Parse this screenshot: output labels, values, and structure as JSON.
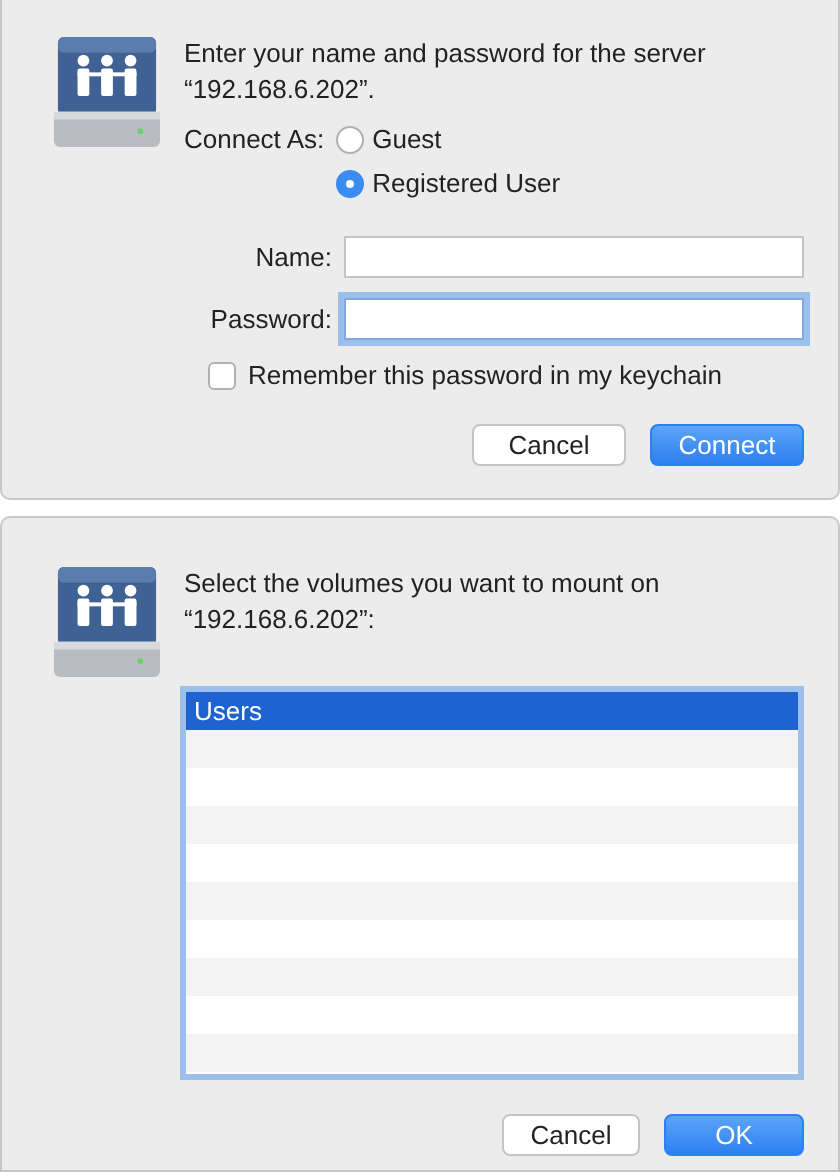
{
  "login_dialog": {
    "message": "Enter your name and password for the server “192.168.6.202”.",
    "connect_as_label": "Connect As:",
    "connect_as_options": [
      {
        "label": "Guest",
        "selected": false
      },
      {
        "label": "Registered User",
        "selected": true
      }
    ],
    "fields": [
      {
        "label": "Name:",
        "focused": false
      },
      {
        "label": "Password:",
        "focused": true
      }
    ],
    "remember": {
      "label": "Remember this password in my keychain",
      "checked": false
    },
    "buttons": [
      {
        "label": "Cancel",
        "default": false
      },
      {
        "label": "Connect",
        "default": true
      }
    ]
  },
  "mount_dialog": {
    "message": "Select the volumes you want to mount on “192.168.6.202”:",
    "volumes": [
      {
        "label": "Users",
        "selected": true
      }
    ],
    "buttons": [
      {
        "label": "Cancel",
        "default": false
      },
      {
        "label": "OK",
        "default": true
      }
    ]
  }
}
